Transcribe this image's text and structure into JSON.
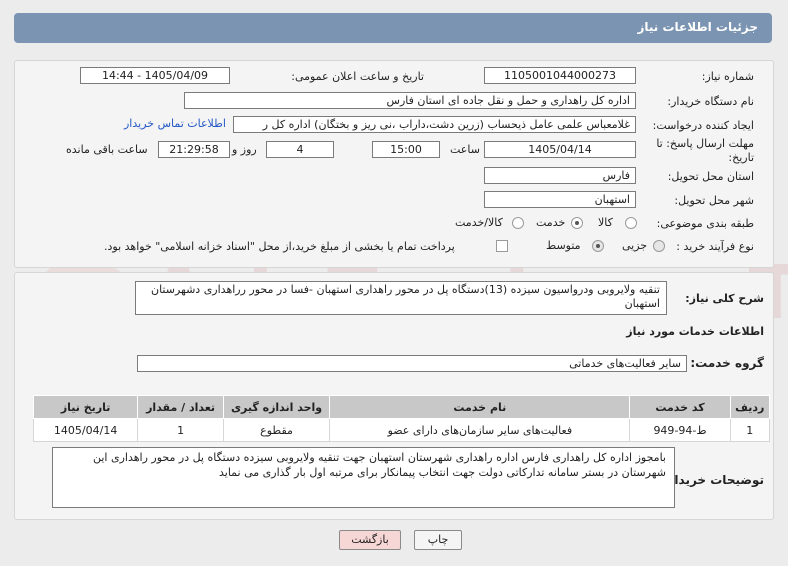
{
  "header": {
    "title": "جزئیات اطلاعات نیاز"
  },
  "form": {
    "need_number_label": "شماره نیاز:",
    "need_number": "1105001044000273",
    "announce_label": "تاریخ و ساعت اعلان عمومی:",
    "announce_value": "1405/04/09 - 14:44",
    "buyer_org_label": "نام دستگاه خریدار:",
    "buyer_org": "اداره کل راهداری و حمل و نقل جاده ای استان فارس",
    "creator_label": "ایجاد کننده درخواست:",
    "creator": "غلامعباس علمی عامل ذیحساب (زرین دشت،داراب ،نی ریز و بختگان) اداره کل ر",
    "contact_link": "اطلاعات تماس خریدار",
    "deadline_label": "مهلت ارسال پاسخ: تا تاریخ:",
    "deadline_date": "1405/04/14",
    "time_label": "ساعت",
    "deadline_time": "15:00",
    "days_value": "4",
    "days_label": "روز و",
    "remain_time": "21:29:58",
    "remain_label": "ساعت باقی مانده",
    "province_label": "استان محل تحویل:",
    "province": "فارس",
    "city_label": "شهر محل تحویل:",
    "city": "استهبان",
    "category_label": "طبقه بندی موضوعی:",
    "category_options": {
      "goods": "کالا",
      "service": "خدمت",
      "both": "کالا/خدمت"
    },
    "category_selected": "خدمت",
    "process_label": "نوع فرآیند خرید :",
    "process_options": {
      "minor": "جزیی",
      "medium": "متوسط"
    },
    "process_selected": "متوسط",
    "payment_note": "پرداخت تمام یا بخشی از مبلغ خرید،از محل \"اسناد خزانه اسلامی\" خواهد بود."
  },
  "summary": {
    "label": "شرح کلی نیاز:",
    "text": "تنقیه ولایروبی ودرواسیون سیزده (13)دستگاه پل در محور راهداری استهبان -فسا در محور رراهداری دشهرستان استهبان"
  },
  "services": {
    "section_title": "اطلاعات خدمات مورد نیاز",
    "group_label": "گروه خدمت:",
    "group_value": "سایر فعالیت‌های خدماتی",
    "columns": [
      "ردیف",
      "کد خدمت",
      "نام خدمت",
      "واحد اندازه گیری",
      "تعداد / مقدار",
      "تاریخ نیاز"
    ],
    "rows": [
      [
        "1",
        "ط-94-949",
        "فعالیت‌های سایر سازمان‌های دارای عضو",
        "مقطوع",
        "1",
        "1405/04/14"
      ]
    ]
  },
  "buyer_notes": {
    "label": "توضیحات خریدار:",
    "text": "بامجوز اداره کل راهداری فارس اداره راهداری شهرستان استهبان جهت تنقیه ولایروبی سیزده دستگاه پل در محور راهداری این شهرستان   در بستر سامانه تدارکاتی دولت جهت انتخاب پیمانکار برای مرتبه اول بار گذاری می نماید"
  },
  "buttons": {
    "print": "چاپ",
    "back": "بازگشت"
  },
  "watermark": {
    "text": "AriaTender.neT"
  },
  "colors": {
    "header": "#7a94b2",
    "link": "#2357c8",
    "back_button": "#f7d6d6"
  }
}
